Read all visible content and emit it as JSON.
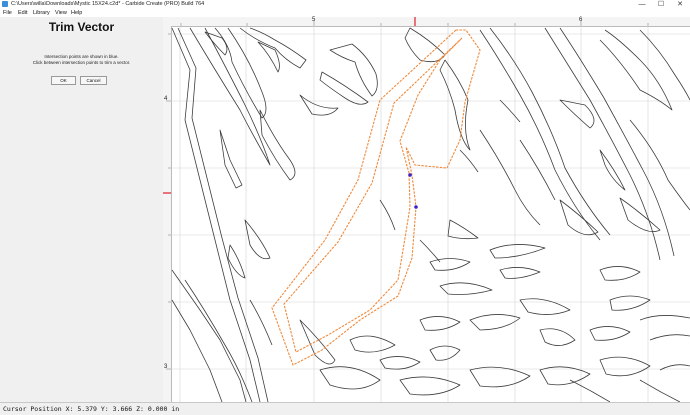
{
  "window": {
    "title": "C:\\Users\\willa\\Downloads\\Mystic 15X24.c2d* - Carbide Create (PRO) Build 764",
    "minimize": "—",
    "maximize": "☐",
    "close": "✕"
  },
  "menu": [
    "File",
    "Edit",
    "Library",
    "View",
    "Help"
  ],
  "panel": {
    "title": "Trim Vector",
    "message_line1": "Intersection points are shown in blue.",
    "message_line2": "Click between intersection points to trim a vector.",
    "ok_label": "OK",
    "cancel_label": "Cancel"
  },
  "rulers": {
    "top_labels": [
      "5",
      "6"
    ],
    "left_labels": [
      "4",
      "3"
    ],
    "marker_color": "#e0202a"
  },
  "status": {
    "cursor_label": "Cursor Position",
    "x_label": "X:",
    "x": "5.379",
    "y_label": "Y:",
    "y": "3.666",
    "z_label": "Z:",
    "z": "0.000",
    "unit": "in"
  },
  "colors": {
    "selected_vector": "#f08a3c",
    "intersection_point": "#3a24c8",
    "vector": "#3c3c3c",
    "grid": "#d6d6d6"
  }
}
